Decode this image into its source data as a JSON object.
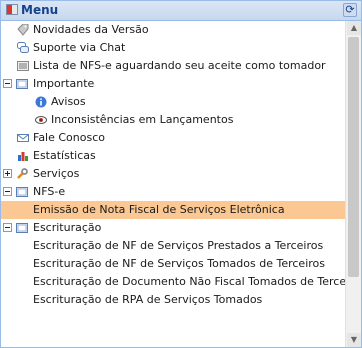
{
  "panel": {
    "title": "Menu",
    "refresh_icon": "refresh-icon"
  },
  "tree": {
    "items": [
      {
        "label": "Novidades da Versão",
        "icon": "tag-icon"
      },
      {
        "label": "Suporte via Chat",
        "icon": "chat-icon"
      },
      {
        "label": "Lista de NFS-e aguardando seu aceite como tomador",
        "icon": "list-icon"
      },
      {
        "label": "Importante",
        "icon": "folder-icon",
        "expanded": true
      },
      {
        "label": "Avisos",
        "icon": "info-icon"
      },
      {
        "label": "Inconsistências em Lançamentos",
        "icon": "eye-icon"
      },
      {
        "label": "Fale Conosco",
        "icon": "mail-icon"
      },
      {
        "label": "Estatísticas",
        "icon": "bar-chart-icon"
      },
      {
        "label": "Serviços",
        "icon": "wrench-icon",
        "expanded": false
      },
      {
        "label": "NFS-e",
        "icon": "folder-icon",
        "expanded": true
      },
      {
        "label": "Emissão de Nota Fiscal de Serviços Eletrônica",
        "selected": true
      },
      {
        "label": "Escrituração",
        "icon": "folder-icon",
        "expanded": true
      },
      {
        "label": "Escrituração de NF de Serviços Prestados a Terceiros"
      },
      {
        "label": "Escrituração de NF de Serviços Tomados de Terceiros"
      },
      {
        "label": "Escrituração de Documento Não Fiscal Tomados de Terce"
      },
      {
        "label": "Escrituração de RPA de Serviços Tomados"
      }
    ]
  },
  "colors": {
    "selected": "#fbc894",
    "header_text": "#15428b"
  }
}
